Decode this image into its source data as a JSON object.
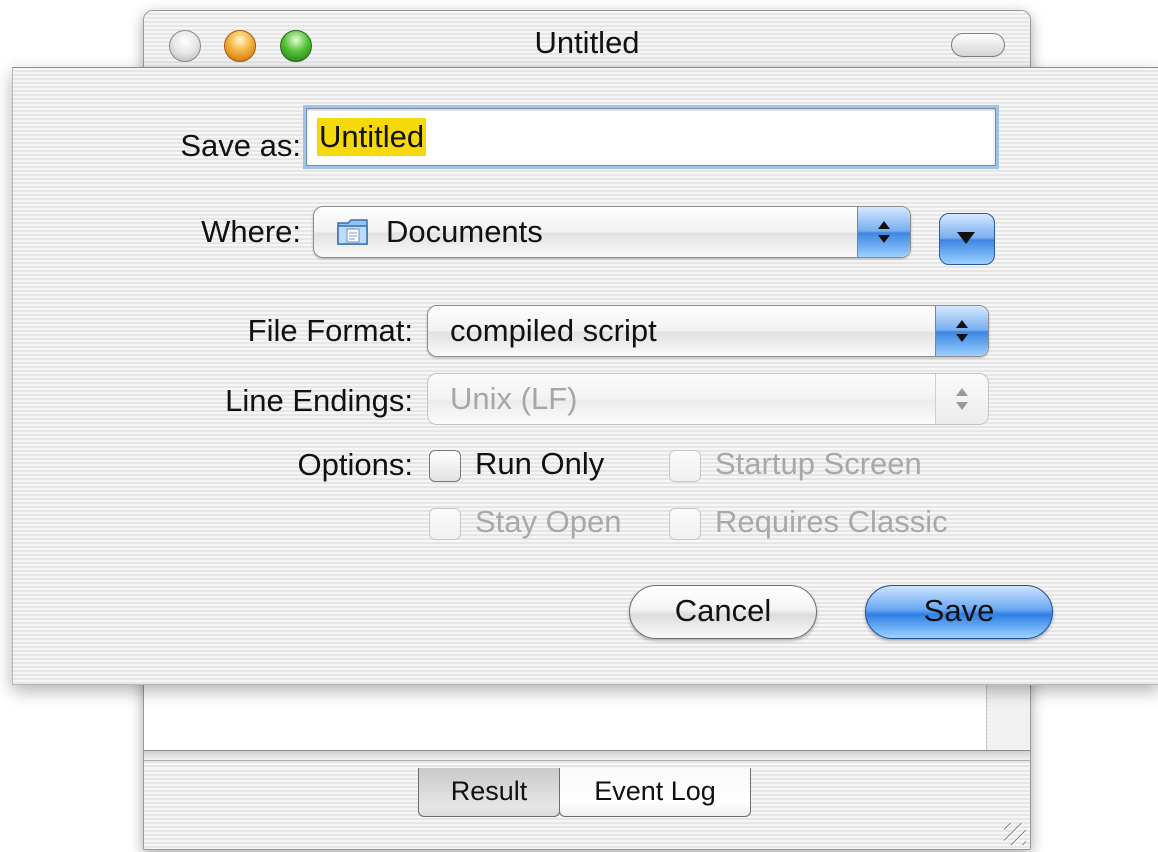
{
  "window": {
    "title": "Untitled",
    "tabs": [
      {
        "label": "Result"
      },
      {
        "label": "Event Log"
      }
    ]
  },
  "save_sheet": {
    "save_as_label": "Save as:",
    "filename": "Untitled",
    "where_label": "Where:",
    "where_value": "Documents",
    "file_format_label": "File Format:",
    "file_format_value": "compiled script",
    "line_endings_label": "Line Endings:",
    "line_endings_value": "Unix (LF)",
    "options_label": "Options:",
    "options": {
      "run_only": {
        "label": "Run Only",
        "checked": false,
        "enabled": true
      },
      "startup_screen": {
        "label": "Startup Screen",
        "checked": false,
        "enabled": false
      },
      "stay_open": {
        "label": "Stay Open",
        "checked": false,
        "enabled": false
      },
      "requires_classic": {
        "label": "Requires Classic",
        "checked": false,
        "enabled": false
      }
    },
    "cancel_label": "Cancel",
    "save_label": "Save"
  },
  "colors": {
    "accent_blue": "#3d86e2",
    "selection_highlight": "#f5d90a",
    "focus_ring": "#9fc3ea"
  },
  "icons": {
    "folder": "documents-folder-icon",
    "popup_arrows": "up-down-arrows-icon",
    "expand": "disclosure-triangle-icon",
    "grip": "resize-grip-icon"
  }
}
